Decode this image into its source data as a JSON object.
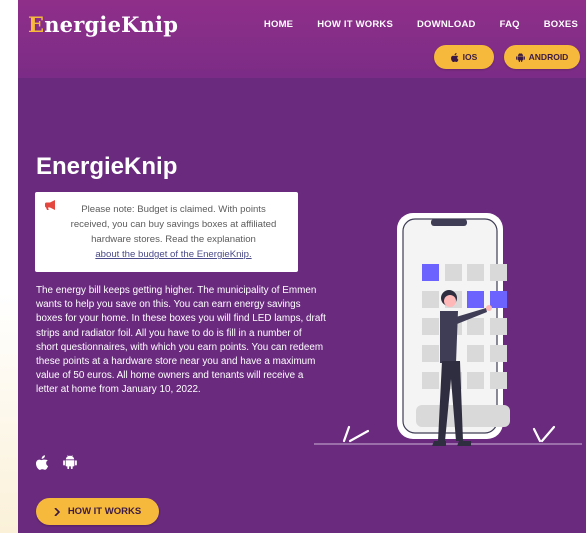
{
  "header": {
    "logo_prefix": "E",
    "logo_rest": "nergieKnip",
    "nav": [
      {
        "label": "HOME"
      },
      {
        "label": "HOW IT WORKS"
      },
      {
        "label": "DOWNLOAD"
      },
      {
        "label": "FAQ"
      },
      {
        "label": "BOXES"
      }
    ],
    "ios_button": {
      "label": "IOS",
      "icon": "apple-icon"
    },
    "android_button": {
      "label": "ANDROID",
      "icon": "android-icon"
    }
  },
  "hero": {
    "title": "EnergieKnip",
    "notice": {
      "icon": "megaphone-icon",
      "text": "Please note: Budget is claimed. With points received, you can buy savings boxes at affiliated hardware stores. Read the explanation",
      "link_text": "about the budget of the EnergieKnip."
    },
    "body": "The energy bill keeps getting higher. The municipality of Emmen wants to help you save on this. You can earn energy savings boxes for your home. In these boxes you will find LED lamps, draft strips and radiator foil. All you have to do is fill in a number of short questionnaires, with which you earn points. You can redeem these points at a hardware store near you and have a maximum value of 50 euros. All home owners and tenants will receive a letter at home from January 10, 2022.",
    "os_icons": [
      "apple-icon",
      "android-icon"
    ],
    "cta": {
      "label": "HOW IT WORKS",
      "icon": "chevron-right-icon"
    }
  },
  "colors": {
    "brand_purple": "#6a2b7f",
    "header_purple": "#8f2f8a",
    "accent_yellow": "#f6b93b",
    "highlight_tile": "#6c63ff"
  }
}
